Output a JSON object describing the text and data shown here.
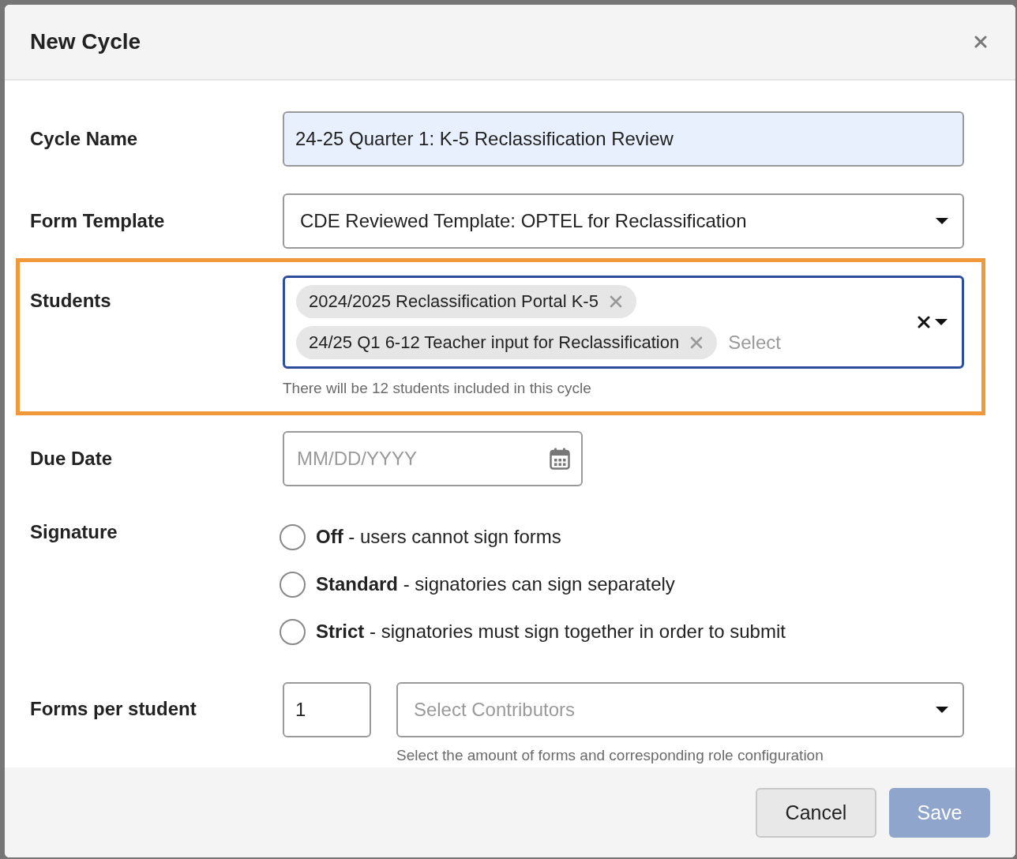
{
  "dialog": {
    "title": "New Cycle"
  },
  "fields": [
    {
      "kind": "text",
      "label": "Cycle Name",
      "value": "24-25 Quarter 1: K-5 Reclassification Review",
      "autofilled": true
    },
    {
      "kind": "select",
      "label": "Form Template",
      "value": "CDE Reviewed Template: OPTEL for Reclassification"
    },
    {
      "kind": "multiselect",
      "label": "Students",
      "highlighted": true,
      "focused": true,
      "tags": [
        "2024/2025 Reclassification Portal K-5",
        "24/25 Q1 6-12 Teacher input for Reclassification"
      ],
      "placeholder": "Select",
      "hint": "There will be 12 students included in this cycle"
    },
    {
      "kind": "date",
      "label": "Due Date",
      "placeholder": "MM/DD/YYYY"
    },
    {
      "kind": "radio",
      "label": "Signature",
      "options": [
        {
          "text": "**Off** - users cannot sign forms",
          "selected": false
        },
        {
          "text": "**Standard** - signatories can sign separately",
          "selected": false
        },
        {
          "text": "**Strict** - signatories must sign together in order to submit",
          "selected": false
        }
      ]
    },
    {
      "kind": "forms",
      "label": "Forms per student",
      "count": "1",
      "contributors_placeholder": "Select Contributors",
      "hint": "Select the amount of forms and corresponding role configuration"
    }
  ],
  "buttons": [
    {
      "label": "Cancel",
      "kind": "secondary",
      "disabled": false
    },
    {
      "label": "Save",
      "kind": "primary",
      "disabled": true
    }
  ]
}
